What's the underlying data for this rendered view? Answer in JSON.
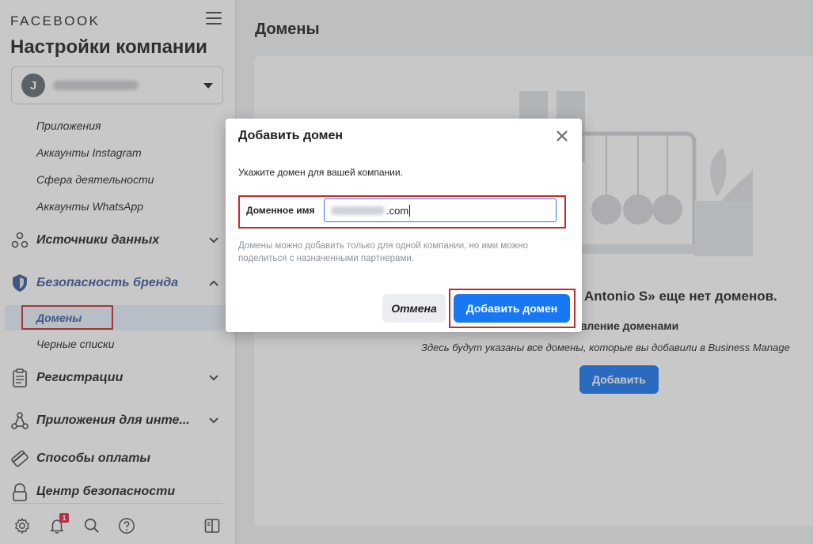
{
  "sidebar": {
    "brand": "FACEBOOK",
    "title": "Настройки компании",
    "account": {
      "avatar_letter": "J"
    },
    "sub_items": {
      "apps": "Приложения",
      "instagram": "Аккаунты Instagram",
      "industry": "Сфера деятельности",
      "whatsapp": "Аккаунты WhatsApp",
      "domains": "Домены",
      "blocklists": "Черные списки"
    },
    "sections": {
      "data_sources": "Источники данных",
      "brand_safety": "Безопасность бренда",
      "registrations": "Регистрации",
      "integrations": "Приложения для инте...",
      "payments": "Способы оплаты",
      "security_center": "Центр безопасности"
    },
    "footer": {
      "notification_count": "1"
    }
  },
  "main": {
    "title": "Домены",
    "empty_heading": "Antonio S» еще нет доменов.",
    "empty_sub": "вление доменами",
    "empty_desc": "Здесь будут указаны все домены, которые вы добавили в Business Manage",
    "add_button": "Добавить"
  },
  "dialog": {
    "title": "Добавить домен",
    "prompt": "Укажите домен для вашей компании.",
    "field_label": "Доменное имя",
    "field_value_suffix": ".com",
    "note": "Домены можно добавить только для одной компании, но ими можно поделиться с назначенными партнерами.",
    "cancel": "Отмена",
    "submit": "Добавить домен"
  },
  "colors": {
    "accent": "#1877f2",
    "brand_safety_active": "#385898",
    "highlight_border": "#c32b2b",
    "notification_badge": "#e41e3f"
  },
  "icons": [
    "menu-icon",
    "chevron-down-icon",
    "data-sources-icon",
    "shield-icon",
    "chevron-up-icon",
    "clipboard-icon",
    "integrations-icon",
    "credit-card-icon",
    "lock-icon",
    "settings-icon",
    "bell-icon",
    "search-icon",
    "help-icon",
    "panel-toggle-icon",
    "close-icon"
  ]
}
